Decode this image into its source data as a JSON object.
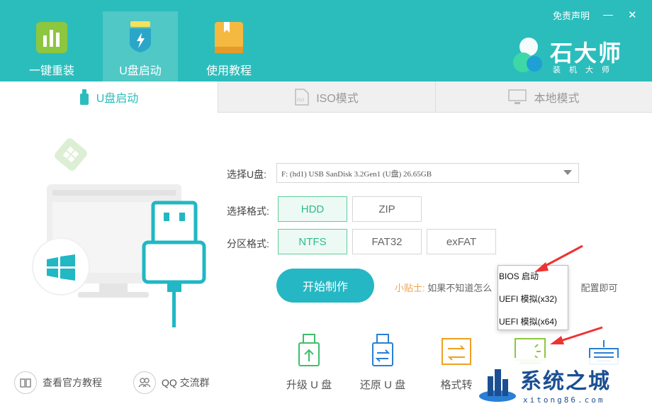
{
  "header": {
    "nav": [
      {
        "label": "一键重装"
      },
      {
        "label": "U盘启动"
      },
      {
        "label": "使用教程"
      }
    ],
    "disclaimer": "免责声明",
    "minimize": "—",
    "close": "✕",
    "brand": {
      "name": "石大师",
      "sub": "装机大师"
    }
  },
  "tabs": [
    {
      "label": "U盘启动"
    },
    {
      "label": "ISO模式"
    },
    {
      "label": "本地模式"
    }
  ],
  "form": {
    "usb_label": "选择U盘:",
    "usb_value": "F: (hd1) USB SanDisk 3.2Gen1 (U盘) 26.65GB",
    "format_label": "选择格式:",
    "format_options": [
      "HDD",
      "ZIP"
    ],
    "partition_label": "分区格式:",
    "partition_options": [
      "NTFS",
      "FAT32",
      "exFAT"
    ],
    "start_button": "开始制作",
    "tip_prefix": "小贴士:",
    "tip_text_left": "如果不知道怎么",
    "tip_text_right": "配置即可"
  },
  "dropdown": [
    "BIOS 启动",
    "UEFI 模拟(x32)",
    "UEFI 模拟(x64)"
  ],
  "tools": [
    {
      "label": "升级 U 盘"
    },
    {
      "label": "还原 U 盘"
    },
    {
      "label": "格式转"
    }
  ],
  "bottom": {
    "tutorial": "查看官方教程",
    "qq": "QQ 交流群"
  },
  "watermark": {
    "title": "系统之城",
    "url": "xitong86.com"
  },
  "colors": {
    "teal": "#2bbdbc",
    "green": "#2bbd8c",
    "button": "#26b7c4",
    "tip": "#f0a34a"
  }
}
